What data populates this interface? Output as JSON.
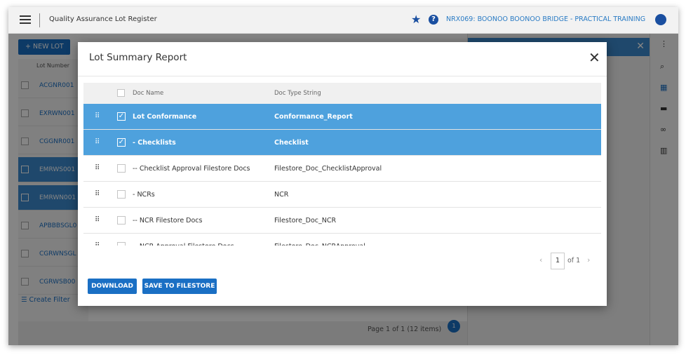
{
  "header": {
    "app_title": "Quality Assurance  Lot Register",
    "project_name": "NRX069: BOONOO BOONOO BRIDGE - PRACTICAL TRAINING"
  },
  "background": {
    "new_lot_label": "+ NEW LOT",
    "column_header": "Lot Number",
    "rows": [
      {
        "label": "ACGNR001",
        "selected": false
      },
      {
        "label": "EXRWN001",
        "selected": false
      },
      {
        "label": "CGGNR001",
        "selected": false
      },
      {
        "label": "EMRWS001",
        "selected": true
      },
      {
        "label": "EMRWN001",
        "selected": true
      },
      {
        "label": "APBBBSGL0",
        "selected": false
      },
      {
        "label": "CGRWNSGL",
        "selected": false
      },
      {
        "label": "CGRWSB00",
        "selected": false
      }
    ],
    "create_filter": "Create Filter",
    "page_info": "Page 1 of 1 (12 items)",
    "page_badge": "1"
  },
  "modal": {
    "title": "Lot Summary Report",
    "columns": {
      "name": "Doc Name",
      "type": "Doc Type String"
    },
    "rows": [
      {
        "name": "Lot Conformance",
        "type": "Conformance_Report",
        "checked": true
      },
      {
        "name": "- Checklists",
        "type": "Checklist",
        "checked": true
      },
      {
        "name": "-- Checklist Approval Filestore Docs",
        "type": "Filestore_Doc_ChecklistApproval",
        "checked": false
      },
      {
        "name": "- NCRs",
        "type": "NCR",
        "checked": false
      },
      {
        "name": "-- NCR Filestore Docs",
        "type": "Filestore_Doc_NCR",
        "checked": false
      },
      {
        "name": "-- NCR Approval Filestore Docs",
        "type": "Filestore_Doc_NCRApproval",
        "checked": false
      }
    ],
    "pager": {
      "current": "1",
      "of_label": "of 1"
    },
    "download_label": "DOWNLOAD",
    "save_label": "SAVE TO FILESTORE"
  },
  "colors": {
    "accent": "#1a6fc4",
    "selected_row": "#4ea1dd"
  }
}
